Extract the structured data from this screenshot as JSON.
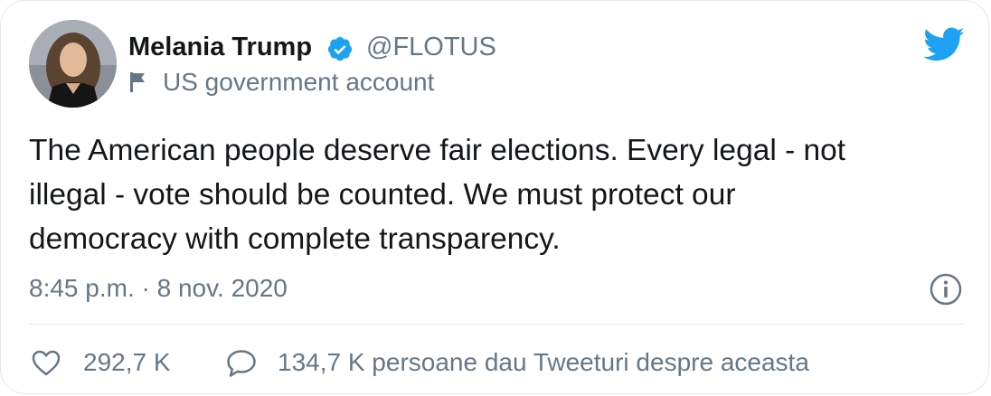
{
  "author": {
    "name": "Melania Trump",
    "handle": "@FLOTUS",
    "label": "US government account",
    "verified": true
  },
  "icons": {
    "avatar": "profile-avatar",
    "verified": "verified-badge-icon",
    "label": "flag-icon",
    "brand": "twitter-bird-icon",
    "info": "info-icon",
    "like": "heart-icon",
    "reply": "speech-bubble-icon"
  },
  "tweet": {
    "lines": [
      "The American people deserve fair elections. Every legal - not",
      "illegal - vote should be counted. We must protect our",
      "democracy with complete transparency."
    ],
    "timestamp": "8:45 p.m. · 8 nov. 2020"
  },
  "stats": {
    "likes": "292,7 K",
    "people_talking": "134,7 K persoane dau Tweeturi despre aceasta"
  },
  "colors": {
    "accent": "#1da1f2",
    "text": "#14171a",
    "secondary": "#657786",
    "border": "#e1e8ed"
  }
}
